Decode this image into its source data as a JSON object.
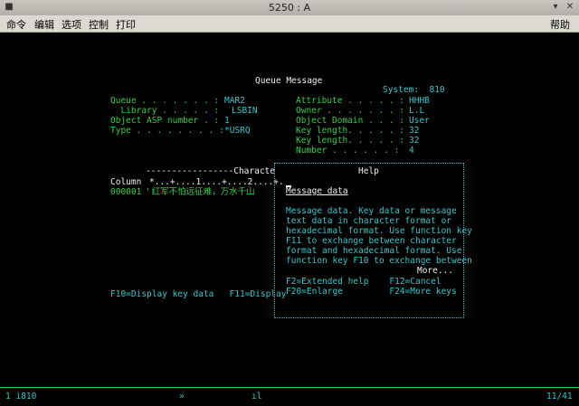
{
  "window": {
    "title": "5250 : A"
  },
  "menu": {
    "items": [
      "命令",
      "编辑",
      "选项",
      "控制",
      "打印"
    ],
    "help": "帮助"
  },
  "screen": {
    "header": "Queue Message",
    "system": "System:  810",
    "left_fields": [
      {
        "label": "Queue . . . . . . . :",
        "value": "MAR2"
      },
      {
        "label": "  Library . . . . . :",
        "value": "LSBIN"
      },
      {
        "label": "Object ASP number . :",
        "value": "1"
      },
      {
        "label": "Type . . . . . . . . :",
        "value": "*USRQ"
      }
    ],
    "right_fields": [
      {
        "label": "Attribute . . . . . :",
        "value": "HHHB"
      },
      {
        "label": "Owner . . . . . . . :",
        "value": "L.L"
      },
      {
        "label": "Object Domain . . . :",
        "value": "User"
      },
      {
        "label": "Key length. . . . . :",
        "value": "32"
      },
      {
        "label": "Key length. . . . . :",
        "value": "32"
      },
      {
        "label": "Number . . . . . . :",
        "value": "4"
      }
    ],
    "ruler_title": "-----------------Characte",
    "column_label": "Column",
    "ruler": "*...+....1....+....2....+.",
    "row_number": "000001",
    "row_data": "' 红军不怕远征难，万水千山",
    "fkeys_left": "F10=Display key data   F11=Display",
    "help": {
      "title": "Help",
      "topic": "Message data",
      "body": [
        "Message data. Key data or message",
        "text data in character format or",
        "hexadecimal format. Use function key",
        "F11 to exchange between character",
        "format and hexadecimal format. Use",
        "function key F10 to exchange between"
      ],
      "more": "More...",
      "keys1": "F2=Extended help    F12=Cancel",
      "keys2": "F20=Enlarge         F24=More keys"
    }
  },
  "status": {
    "left": "1 i810",
    "mid1": "»",
    "mid2": "ıl",
    "right": "11/41"
  }
}
